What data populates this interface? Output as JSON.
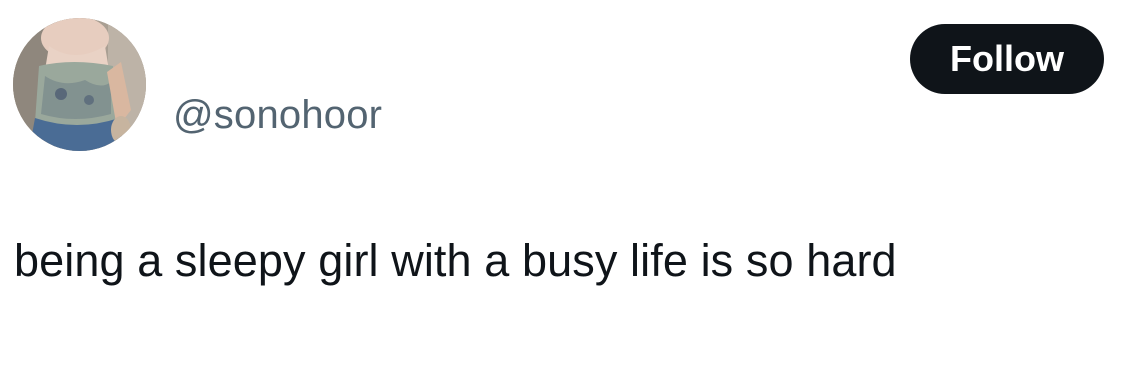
{
  "tweet": {
    "avatar_icon": "profile-photo",
    "handle": "@sonohoor",
    "follow_label": "Follow",
    "text": "being a sleepy girl with a busy life is so hard"
  },
  "colors": {
    "background": "#ffffff",
    "handle": "#536471",
    "text": "#0f1419",
    "button_bg": "#0f1419",
    "button_text": "#ffffff"
  }
}
